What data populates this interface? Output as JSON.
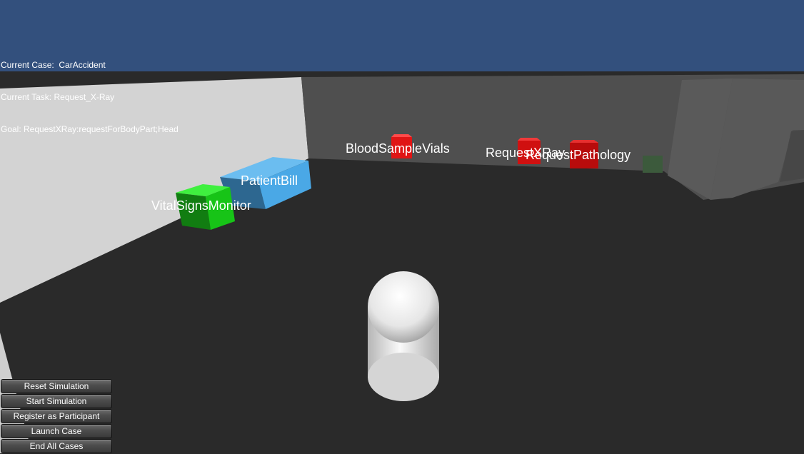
{
  "hud": {
    "current_case": "Current Case:  CarAccident",
    "current_task": "Current Task: Request_X-Ray",
    "goal": "Goal: RequestXRay:requestForBodyPart;Head"
  },
  "scene": {
    "objects": [
      {
        "label": "BloodSampleVials",
        "icon": "red-cube",
        "color": "#e01515"
      },
      {
        "label": "RequestXRay",
        "icon": "red-cube",
        "color": "#d01010"
      },
      {
        "label": "RequestPathology",
        "icon": "red-cube",
        "color": "#c00d0d"
      },
      {
        "label": "PatientBill",
        "icon": "blue-box",
        "color": "#4aa8e6"
      },
      {
        "label": "VitalSignsMonitor",
        "icon": "green-cube",
        "color": "#14c814"
      }
    ],
    "player": {
      "icon": "white-capsule",
      "color": "#f4f4f4"
    }
  },
  "colors": {
    "sky": "#33507d",
    "floor": "#2a2a2a",
    "left_wall": "#d3d3d3",
    "back_wall": "#4f4f4f"
  },
  "buttons": {
    "reset": "Reset Simulation",
    "start": "Start Simulation",
    "register": "Register as Participant",
    "launch": "Launch Case",
    "end_all": "End All Cases"
  }
}
